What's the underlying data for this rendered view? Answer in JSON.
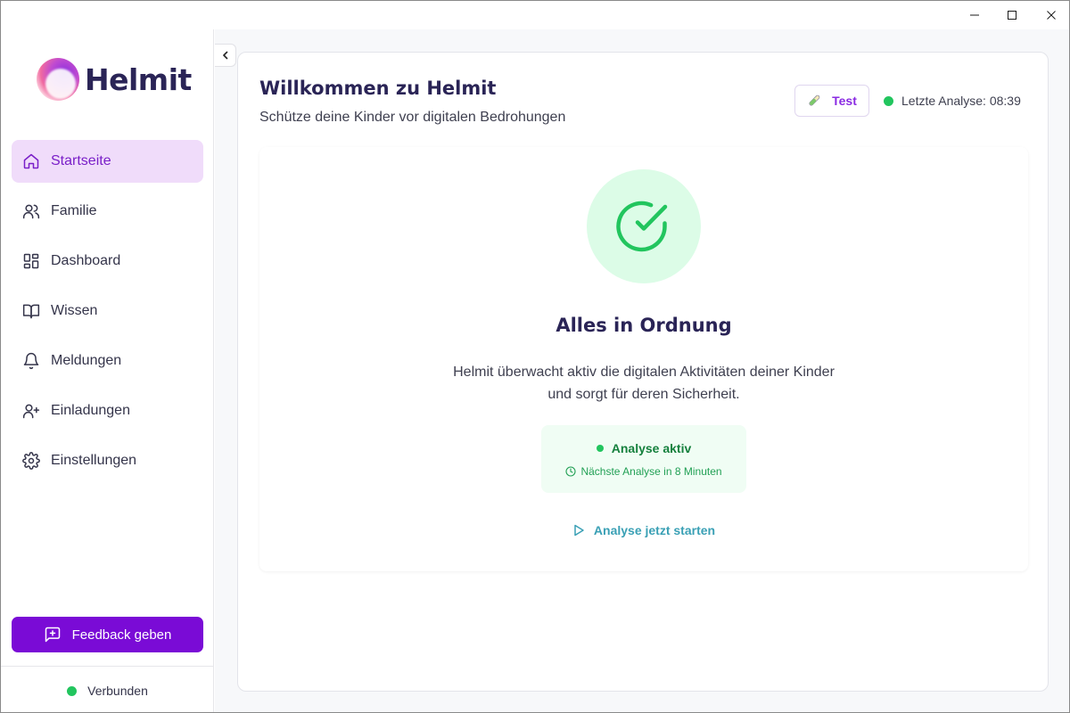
{
  "app": {
    "name": "Helmit"
  },
  "window_controls": {
    "minimize_icon": "minimize-icon",
    "maximize_icon": "maximize-icon",
    "close_icon": "close-icon"
  },
  "sidebar": {
    "items": [
      {
        "label": "Startseite",
        "icon": "home-icon",
        "active": true
      },
      {
        "label": "Familie",
        "icon": "users-icon",
        "active": false
      },
      {
        "label": "Dashboard",
        "icon": "dashboard-icon",
        "active": false
      },
      {
        "label": "Wissen",
        "icon": "book-icon",
        "active": false
      },
      {
        "label": "Meldungen",
        "icon": "bell-icon",
        "active": false
      },
      {
        "label": "Einladungen",
        "icon": "user-plus-icon",
        "active": false
      },
      {
        "label": "Einstellungen",
        "icon": "gear-icon",
        "active": false
      }
    ],
    "feedback_label": "Feedback geben",
    "connection_status": "Verbunden"
  },
  "header": {
    "title": "Willkommen zu Helmit",
    "subtitle": "Schütze deine Kinder vor digitalen Bedrohungen",
    "test_button": "Test",
    "last_analysis": "Letzte Analyse: 08:39"
  },
  "status": {
    "title": "Alles in Ordnung",
    "description": "Helmit überwacht aktiv die digitalen Aktivitäten deiner Kinder und sorgt für deren Sicherheit.",
    "active_label": "Analyse aktiv",
    "next_analysis": "Nächste Analyse in 8 Minuten",
    "start_label": "Analyse jetzt starten"
  },
  "colors": {
    "brand": "#7a0bd6",
    "active_nav_bg": "#f0dcfa",
    "success": "#22c55e",
    "title": "#2a2456",
    "link": "#3aa0b5"
  }
}
